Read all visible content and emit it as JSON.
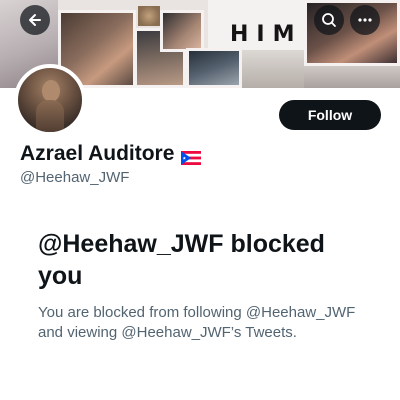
{
  "banner": {
    "text": "HIM"
  },
  "header": {
    "back_icon": "arrow-left-icon",
    "search_icon": "search-icon",
    "more_icon": "more-horizontal-icon"
  },
  "profile": {
    "display_name": "Azrael Auditore",
    "flag_icon": "puerto-rico-flag-icon",
    "handle": "@Heehaw_JWF",
    "follow_label": "Follow"
  },
  "blocked": {
    "title": "@Heehaw_JWF blocked you",
    "message": "You are blocked from following @Heehaw_JWF and viewing @Heehaw_JWF’s Tweets."
  },
  "colors": {
    "primary_text": "#0f1419",
    "secondary_text": "#536471",
    "button_bg": "#0f1419",
    "flag_red": "#ed0a3f",
    "flag_blue": "#0050f0"
  }
}
